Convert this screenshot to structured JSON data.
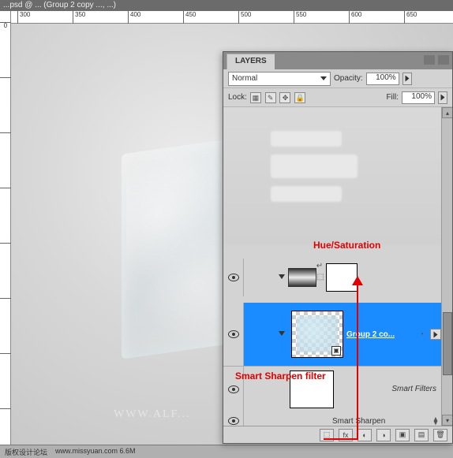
{
  "title_bar": "...psd @ ... (Group 2 copy ..., ...)",
  "ruler_h": [
    "300",
    "350",
    "400",
    "450",
    "500",
    "550",
    "600",
    "650"
  ],
  "ruler_v": [
    "0",
    "",
    "",
    "",
    "",
    ""
  ],
  "watermark": "WWW.ALF...",
  "status": {
    "left": "版权设计论坛",
    "right": "www.missyuan.com 6.6M"
  },
  "panel": {
    "tab": "LAYERS",
    "blend_mode": "Normal",
    "opacity_label": "Opacity:",
    "opacity_value": "100%",
    "lock_label": "Lock:",
    "fill_label": "Fill:",
    "fill_value": "100%",
    "group_label": "Group 2 co...",
    "smart_filters_label": "Smart Filters",
    "smart_sharpen_label": "Smart Sharpen",
    "footer_fx": "fx"
  },
  "annotations": {
    "hue_sat": "Hue/Saturation",
    "smart_sharpen": "Smart Sharpen filter"
  }
}
